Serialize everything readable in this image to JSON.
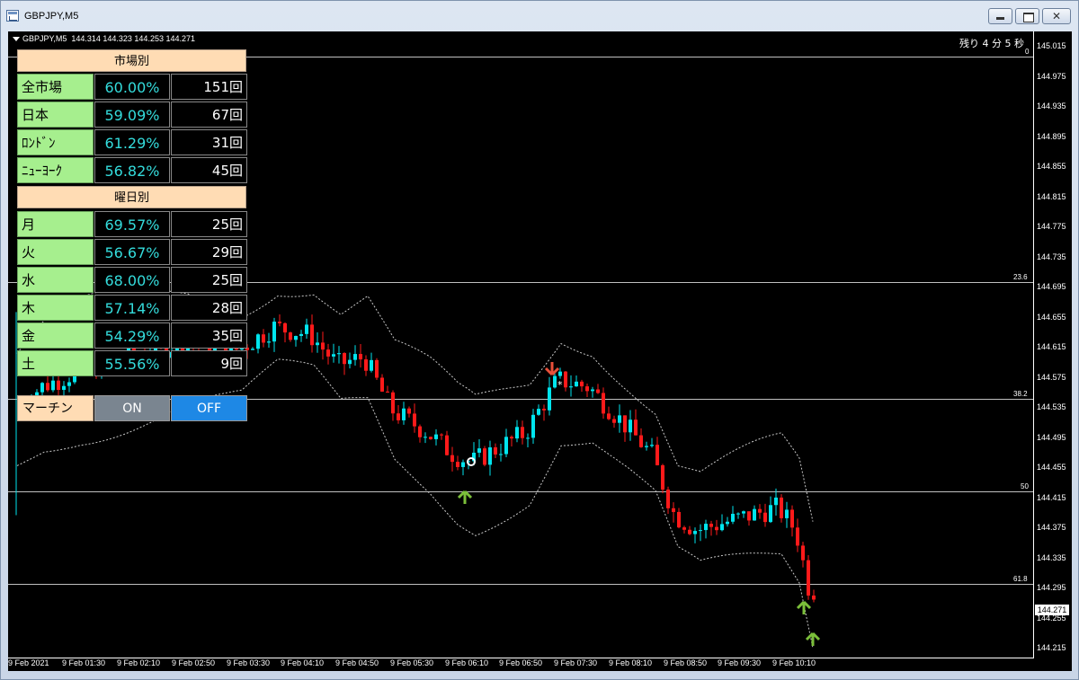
{
  "window": {
    "title": "GBPJPY,M5"
  },
  "chart_info": "GBPJPY,M5  144.314 144.323 144.253 144.271",
  "timer": "残り 4 分 5 秒",
  "colors": {
    "bull": "#00e5ee",
    "bear": "#ff1a1a",
    "up_arrow": "#7bbf3a",
    "down_arrow": "#e8503a",
    "level_line": "#c0c0c0",
    "band": "#c8c8c8"
  },
  "table": {
    "market_header": "市場別",
    "market_rows": [
      {
        "label": "全市場",
        "rate": "60.00%",
        "count": "151回"
      },
      {
        "label": "日本",
        "rate": "59.09%",
        "count": "67回"
      },
      {
        "label": "ﾛﾝﾄﾞﾝ",
        "rate": "61.29%",
        "count": "31回"
      },
      {
        "label": "ﾆｭｰﾖｰｸ",
        "rate": "56.82%",
        "count": "45回"
      }
    ],
    "weekday_header": "曜日別",
    "weekday_rows": [
      {
        "label": "月",
        "rate": "69.57%",
        "count": "25回"
      },
      {
        "label": "火",
        "rate": "56.67%",
        "count": "29回"
      },
      {
        "label": "水",
        "rate": "68.00%",
        "count": "25回"
      },
      {
        "label": "木",
        "rate": "57.14%",
        "count": "28回"
      },
      {
        "label": "金",
        "rate": "54.29%",
        "count": "35回"
      },
      {
        "label": "土",
        "rate": "55.56%",
        "count": "9回"
      }
    ],
    "martin_label": "マーチン",
    "on_label": "ON",
    "off_label": "OFF"
  },
  "price_axis": [
    "145.015",
    "144.975",
    "144.935",
    "144.895",
    "144.855",
    "144.815",
    "144.775",
    "144.735",
    "144.695",
    "144.655",
    "144.615",
    "144.575",
    "144.535",
    "144.495",
    "144.455",
    "144.415",
    "144.375",
    "144.335",
    "144.295",
    "144.255",
    "144.215"
  ],
  "current_price": "144.271",
  "time_axis": [
    "9 Feb 2021",
    "9 Feb 01:30",
    "9 Feb 02:10",
    "9 Feb 02:50",
    "9 Feb 03:30",
    "9 Feb 04:10",
    "9 Feb 04:50",
    "9 Feb 05:30",
    "9 Feb 06:10",
    "9 Feb 06:50",
    "9 Feb 07:30",
    "9 Feb 08:10",
    "9 Feb 08:50",
    "9 Feb 09:30",
    "9 Feb 10:10"
  ],
  "fibo_levels": [
    {
      "label": "0",
      "price": 144.999
    },
    {
      "label": "23.6",
      "price": 144.7
    },
    {
      "label": "38.2",
      "price": 144.545
    },
    {
      "label": "50",
      "price": 144.421
    },
    {
      "label": "61.8",
      "price": 144.298
    }
  ]
}
